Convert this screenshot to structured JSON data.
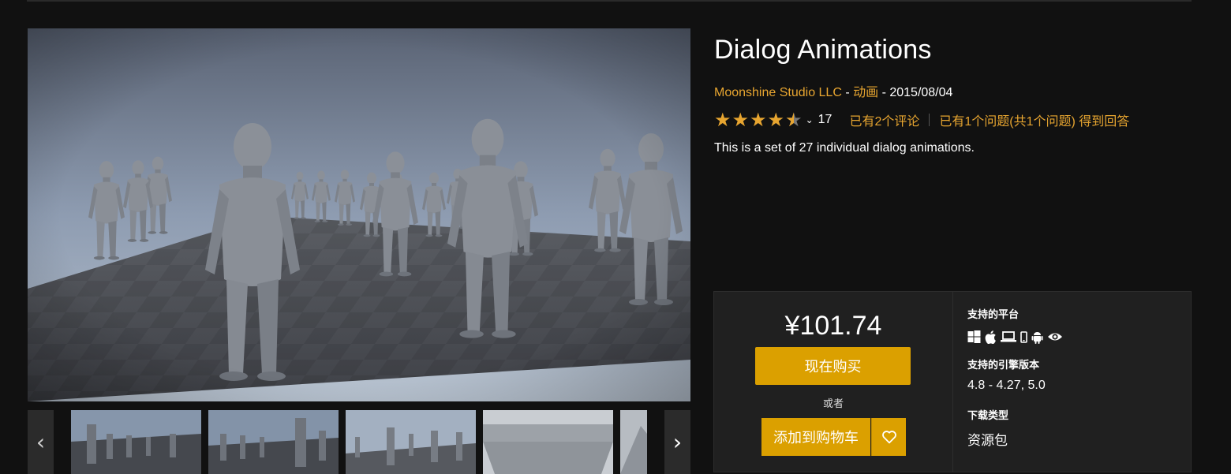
{
  "product": {
    "title": "Dialog Animations",
    "seller": "Moonshine Studio LLC",
    "meta_sep1": " - ",
    "category": "动画",
    "meta_sep2": " - ",
    "release_date": "2015/08/04",
    "rating": 4.5,
    "rating_max": 5,
    "rating_count": "17",
    "reviews_link": "已有2个评论",
    "questions_link": "已有1个问题(共1个问题) 得到回答",
    "description": "This is a set of 27 individual dialog animations."
  },
  "purchase": {
    "price": "¥101.74",
    "buy_label": "现在购买",
    "or_label": "或者",
    "cart_label": "添加到购物车"
  },
  "specs": {
    "platforms_label": "支持的平台",
    "platform_icons": [
      "windows-icon",
      "apple-icon",
      "laptop-icon",
      "mobile-icon",
      "android-icon",
      "vr-eye-icon"
    ],
    "engine_label": "支持的引擎版本",
    "engine_value": "4.8 - 4.27, 5.0",
    "download_label": "下载类型",
    "download_value": "资源包"
  },
  "gallery": {
    "thumbnail_count": 5,
    "prev_icon": "chevron-left-icon",
    "next_icon": "chevron-right-icon"
  },
  "colors": {
    "accent": "#e7a530",
    "button": "#dba000",
    "background": "#111111",
    "panel": "#202020"
  }
}
